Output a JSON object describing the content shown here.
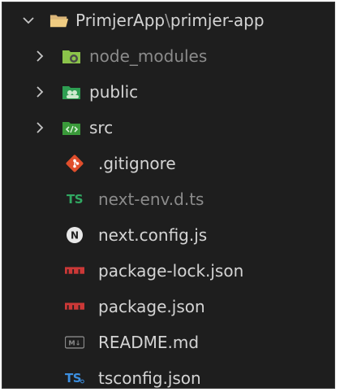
{
  "explorer": {
    "root": {
      "label_prefix": "PrimjerApp",
      "separator": "\\",
      "label_suffix": "primjer-app",
      "expanded": true
    },
    "items": [
      {
        "label": "node_modules",
        "icon": "node-modules-folder-icon",
        "type": "folder",
        "dimmed": true
      },
      {
        "label": "public",
        "icon": "public-folder-icon",
        "type": "folder",
        "dimmed": false
      },
      {
        "label": "src",
        "icon": "src-folder-icon",
        "type": "folder",
        "dimmed": false
      },
      {
        "label": ".gitignore",
        "icon": "git-icon",
        "type": "file",
        "dimmed": false
      },
      {
        "label": "next-env.d.ts",
        "icon": "typescript-def-icon",
        "icon_text": "TS",
        "type": "file",
        "dimmed": true
      },
      {
        "label": "next.config.js",
        "icon": "nextjs-icon",
        "icon_text": "N",
        "type": "file",
        "dimmed": false
      },
      {
        "label": "package-lock.json",
        "icon": "npm-icon",
        "type": "file",
        "dimmed": false
      },
      {
        "label": "package.json",
        "icon": "npm-icon",
        "type": "file",
        "dimmed": false
      },
      {
        "label": "README.md",
        "icon": "markdown-icon",
        "icon_text": "M↓",
        "type": "file",
        "dimmed": false
      },
      {
        "label": "tsconfig.json",
        "icon": "tsconfig-icon",
        "icon_text": "TS",
        "type": "file",
        "dimmed": false
      }
    ]
  }
}
